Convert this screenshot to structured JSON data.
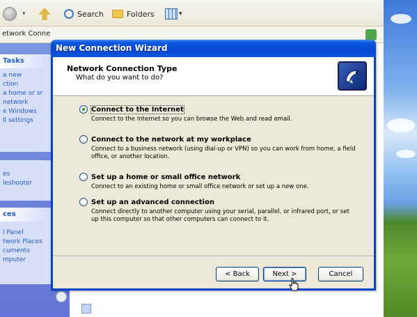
{
  "explorer": {
    "toolbar": {
      "search_label": "Search",
      "folders_label": "Folders"
    },
    "address_text": "etwork Conne",
    "taskpane": {
      "section1_title": "Tasks",
      "section1_items": [
        "a new",
        "ction",
        "a home or sr",
        "network",
        "e Windows",
        "ll settings"
      ],
      "section2_items": [
        "es",
        "leshooter"
      ],
      "section3_title": "ces",
      "section3_items": [
        "l Panel",
        "twork Places",
        "cuments",
        "mputer"
      ]
    }
  },
  "wizard": {
    "title": "New Connection Wizard",
    "header_title": "Network Connection Type",
    "header_subtitle": "What do you want to do?",
    "options": [
      {
        "label": "Connect to the Internet",
        "description": "Connect to the Internet so you can browse the Web and read email.",
        "checked": true
      },
      {
        "label": "Connect to the network at my workplace",
        "description": "Connect to a business network (using dial-up or VPN) so you can work from home, a field office, or another location.",
        "checked": false
      },
      {
        "label": "Set up a home or small office network",
        "description": "Connect to an existing home or small office network or set up a new one.",
        "checked": false
      },
      {
        "label": "Set up an advanced connection",
        "description": "Connect directly to another computer using your serial, parallel, or infrared port, or set up this computer so that other computers can connect to it.",
        "checked": false
      }
    ],
    "buttons": {
      "back": "< Back",
      "next": "Next >",
      "cancel": "Cancel"
    }
  },
  "colors": {
    "titlebar": "#0748d4",
    "dialog_bg": "#ece9d8",
    "radio_dot": "#21a121"
  }
}
